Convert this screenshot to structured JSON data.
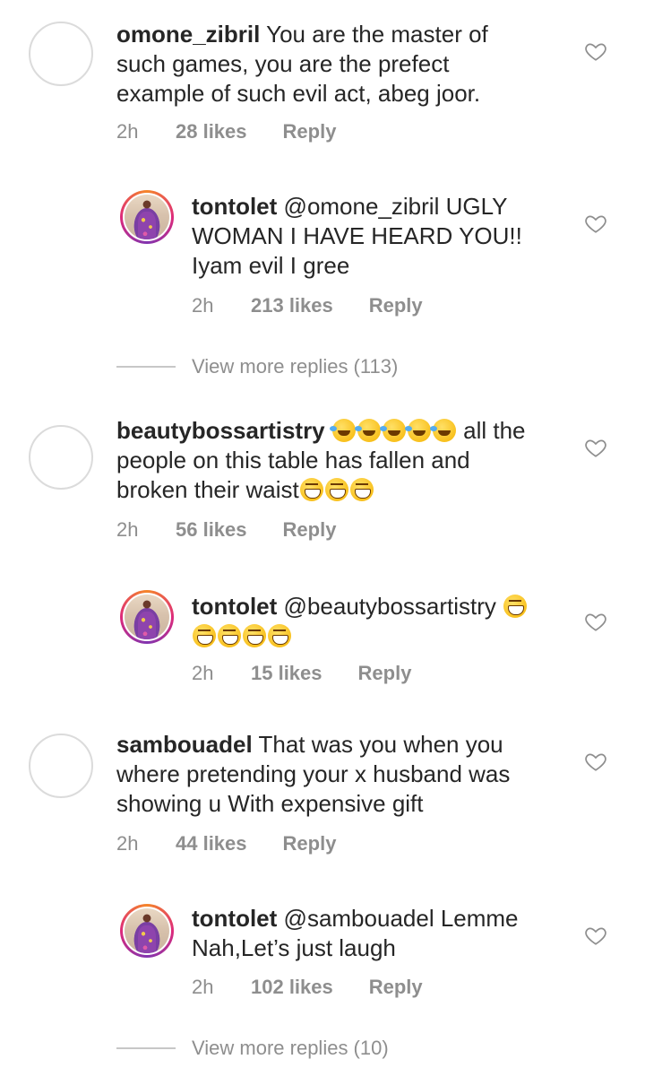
{
  "comments": [
    {
      "username": "omone_zibril",
      "text": "You are the master of such games, you are the prefect example of such evil act, abeg joor.",
      "time": "2h",
      "likes": "28 likes",
      "reply_label": "Reply"
    },
    {
      "username": "tontolet",
      "text": "@omone_zibril UGLY WOMAN I HAVE HEARD YOU!! Iyam evil I gree",
      "time": "2h",
      "likes": "213 likes",
      "reply_label": "Reply"
    },
    {
      "view_more": "View more replies (113)"
    },
    {
      "username": "beautybossartistry",
      "text_after_emoji": "all the people on this table has fallen and broken their waist",
      "time": "2h",
      "likes": "56 likes",
      "reply_label": "Reply"
    },
    {
      "username": "tontolet",
      "text": "@beautybossartistry",
      "time": "2h",
      "likes": "15 likes",
      "reply_label": "Reply"
    },
    {
      "username": "sambouadel",
      "text": "That was you when you where pretending your x husband was showing u With expensive gift",
      "time": "2h",
      "likes": "44 likes",
      "reply_label": "Reply"
    },
    {
      "username": "tontolet",
      "text": "@sambouadel Lemme Nah,Let’s just laugh",
      "time": "2h",
      "likes": "102 likes",
      "reply_label": "Reply"
    },
    {
      "view_more": "View more replies (10)"
    }
  ],
  "icons": {
    "like": "heart-outline-icon",
    "emoji_rofl": "rolling-laughing-emoji",
    "emoji_grin": "grinning-squinting-emoji"
  },
  "colors": {
    "text": "#262626",
    "secondary": "#8e8e8e",
    "divider": "#c7c7c7"
  }
}
